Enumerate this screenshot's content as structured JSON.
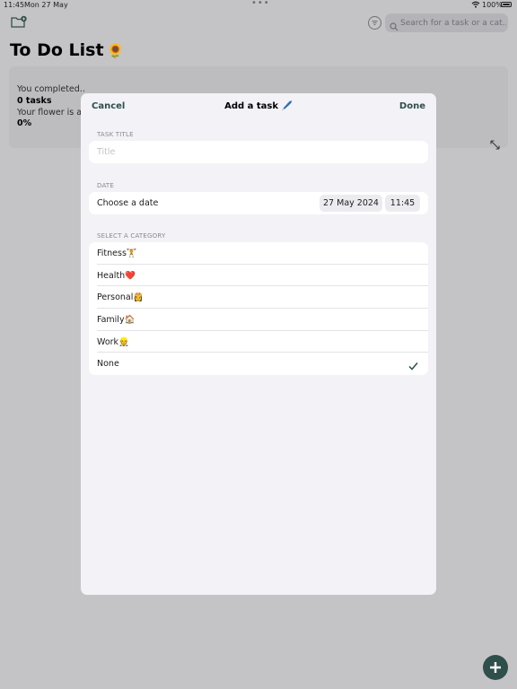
{
  "status_bar": {
    "time": "11:45",
    "date": "Mon 27 May",
    "battery": "100%"
  },
  "search": {
    "placeholder": "Search for a task or a cat..."
  },
  "page": {
    "title": "To Do List",
    "title_emoji": "🌻"
  },
  "stats": {
    "completed_label": "You completed..",
    "tasks_value": "0 tasks",
    "flower_label": "Your flower is at..",
    "percent_value": "0%"
  },
  "modal": {
    "cancel_label": "Cancel",
    "title": "Add a task 🖊️",
    "done_label": "Done",
    "task_title_section": "TASK TITLE",
    "title_placeholder": "Title",
    "date_section": "DATE",
    "date_row_label": "Choose a date",
    "date_value": "27 May 2024",
    "time_value": "11:45",
    "category_section": "SELECT A CATEGORY",
    "categories": [
      {
        "label": "Fitness🏋️"
      },
      {
        "label": "Health❤️"
      },
      {
        "label": "Personal👸"
      },
      {
        "label": "Family🏠"
      },
      {
        "label": "Work👷"
      },
      {
        "label": "None"
      }
    ],
    "selected_category": "None"
  },
  "colors": {
    "accent": "#2f4f4b",
    "backdrop": "#c4c4c7",
    "sheet": "#f2f2f7"
  },
  "icons": {
    "folder": "folder-add-icon",
    "filter": "filter-icon",
    "search": "search-icon",
    "expand": "expand-arrows-icon",
    "check": "checkmark-icon",
    "add": "plus-icon"
  }
}
